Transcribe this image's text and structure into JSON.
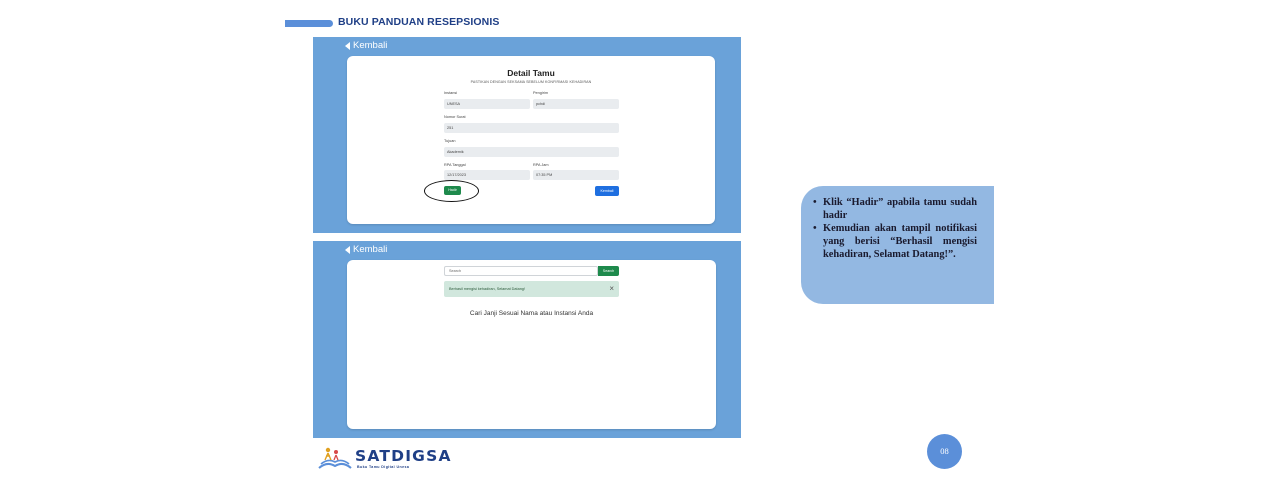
{
  "header": {
    "title": "BUKU PANDUAN RESEPSIONIS"
  },
  "top_screen": {
    "back_label": "Kembali",
    "title": "Detail Tamu",
    "subtitle": "PASTIKAN DENGAN SEKSAMA SEBELUM KONFIRMASI KEHADIRAN",
    "fields": {
      "instansi_label": "Instansi",
      "instansi_value": "UNESA",
      "pengirim_label": "Pengirim",
      "pengirim_value": "pchdi",
      "nomor_surat_label": "Nomor Surat",
      "nomor_surat_value": "251",
      "tujuan_label": "Tujuan",
      "tujuan_value": "Akademik",
      "tanggal_label": "RPA Tanggal",
      "tanggal_value": "12/17/2023",
      "jam_label": "RPA Jam",
      "jam_value": "07:35 PM"
    },
    "hadir_label": "Hadir",
    "kembali_button_label": "Kembali"
  },
  "bottom_screen": {
    "back_label": "Kembali",
    "search_placeholder": "Search",
    "search_button_label": "Search",
    "alert_text": "Berhasil mengisi kehadiran, Selamat Datang!",
    "alert_close": "×",
    "find_text": "Cari Janji Sesuai Nama atau Instansi Anda"
  },
  "note": {
    "items": [
      "Klik “Hadir” apabila tamu sudah hadir",
      "Kemudian akan tampil notifikasi yang berisi “Berhasil mengisi kehadiran, Selamat Datang!”."
    ]
  },
  "footer": {
    "logo_text": "SATDIGSA",
    "logo_tagline": "Buku Tamu Digital Unesa",
    "page_number": "08"
  },
  "colors": {
    "panel": "#6aa2d9",
    "note": "#93b8e2",
    "accent": "#5b8fd9",
    "hadir_button": "#1e8a4c",
    "kembali_button": "#1f6fe0"
  }
}
